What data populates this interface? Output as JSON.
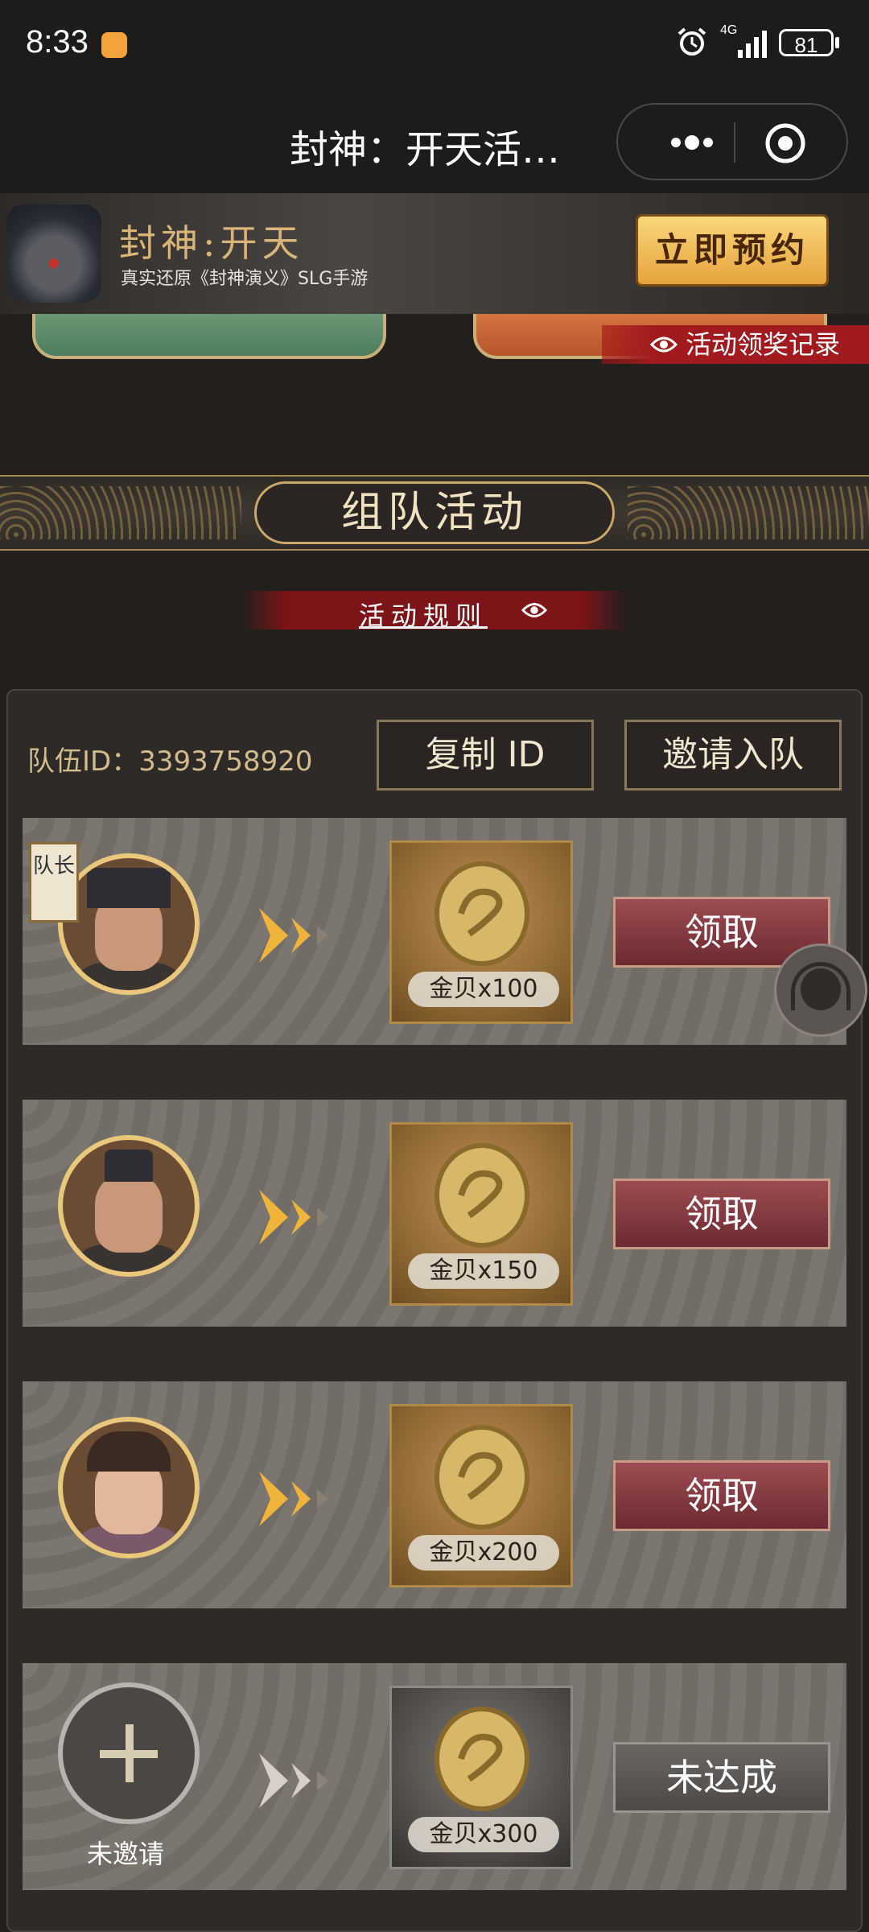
{
  "status_bar": {
    "time": "8:33",
    "network": "4G",
    "battery": "81"
  },
  "title_bar": {
    "title": "封神：开天活…"
  },
  "banner": {
    "game_name": "封神:开天",
    "subtitle": "真实还原《封神演义》SLG手游",
    "reserve_button": "立即预约"
  },
  "top": {
    "record_link": "活动领奖记录"
  },
  "section": {
    "title": "组队活动",
    "rules_link": "活动规则"
  },
  "team": {
    "id_label": "队伍ID：3393758920",
    "copy_button": "复制 ID",
    "invite_button": "邀请入队"
  },
  "rows": [
    {
      "badge": "队长",
      "reward": "金贝x100",
      "action": "领取"
    },
    {
      "reward": "金贝x150",
      "action": "领取"
    },
    {
      "reward": "金贝x200",
      "action": "领取"
    },
    {
      "member": "未邀请",
      "reward": "金贝x300",
      "action": "未达成"
    }
  ],
  "colors": {
    "accent_gold": "#e9c77b",
    "claim_red": "#8a3b42",
    "background": "#231f1d"
  },
  "icons": [
    "notification-icon",
    "alarm-icon",
    "signal-icon",
    "battery-icon",
    "more-icon",
    "target-icon",
    "eye-icon",
    "chevron-right-icon",
    "coin-icon",
    "plus-icon",
    "customer-service-icon"
  ]
}
